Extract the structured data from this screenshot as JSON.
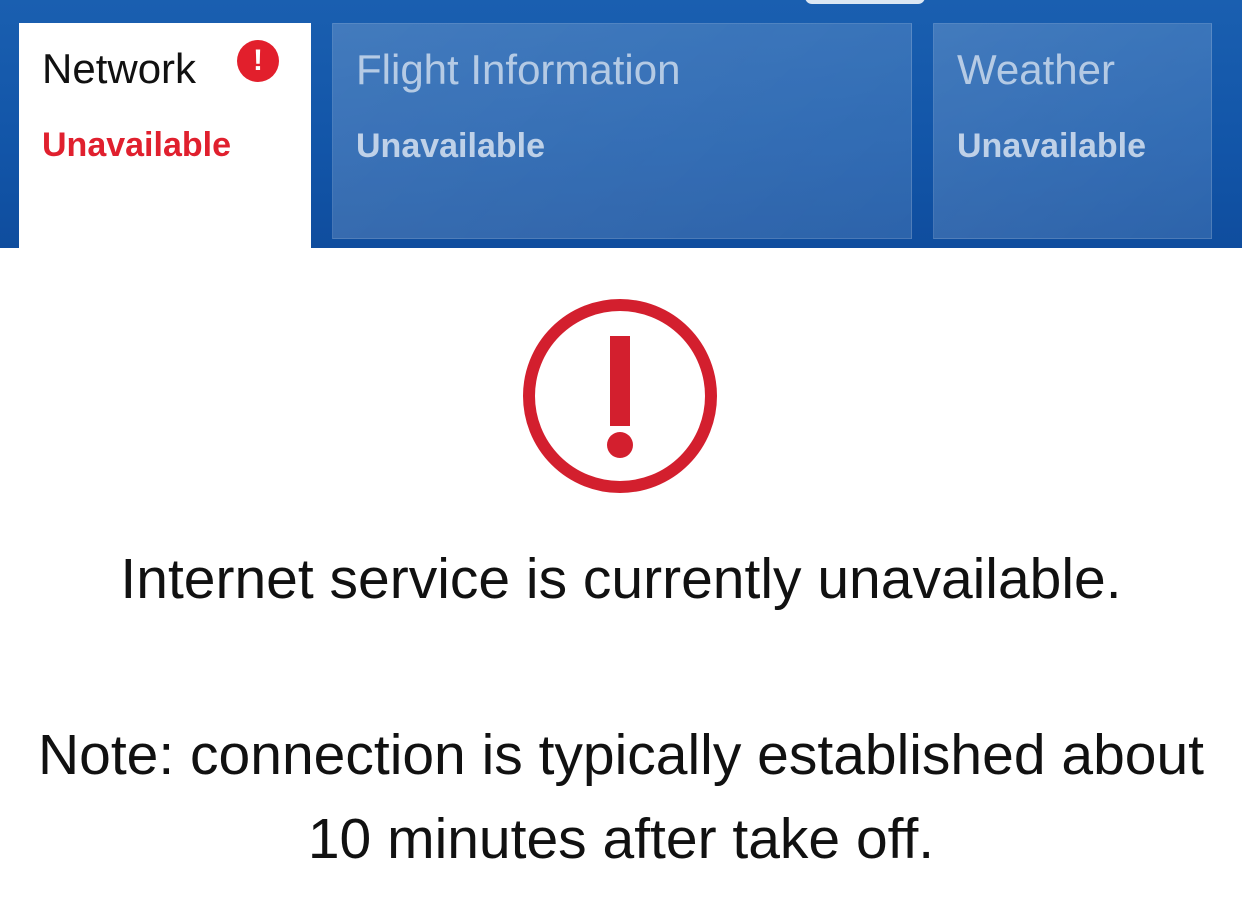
{
  "tabs": [
    {
      "title": "Network",
      "status": "Unavailable",
      "active": true,
      "alert_icon": "exclamation-badge-icon"
    },
    {
      "title": "Flight Information",
      "status": "Unavailable",
      "active": false
    },
    {
      "title": "Weather",
      "status": "Unavailable",
      "active": false
    }
  ],
  "main": {
    "icon": "exclamation-circle-icon",
    "message": "Internet service is currently unavailable.",
    "note_line1": "Note: connection is typically established about",
    "note_line2": "10 minutes after take off."
  },
  "colors": {
    "header_blue": "#1255a8",
    "alert_red": "#d31f2e",
    "status_red": "#e0202e"
  },
  "badge_glyph": "!"
}
